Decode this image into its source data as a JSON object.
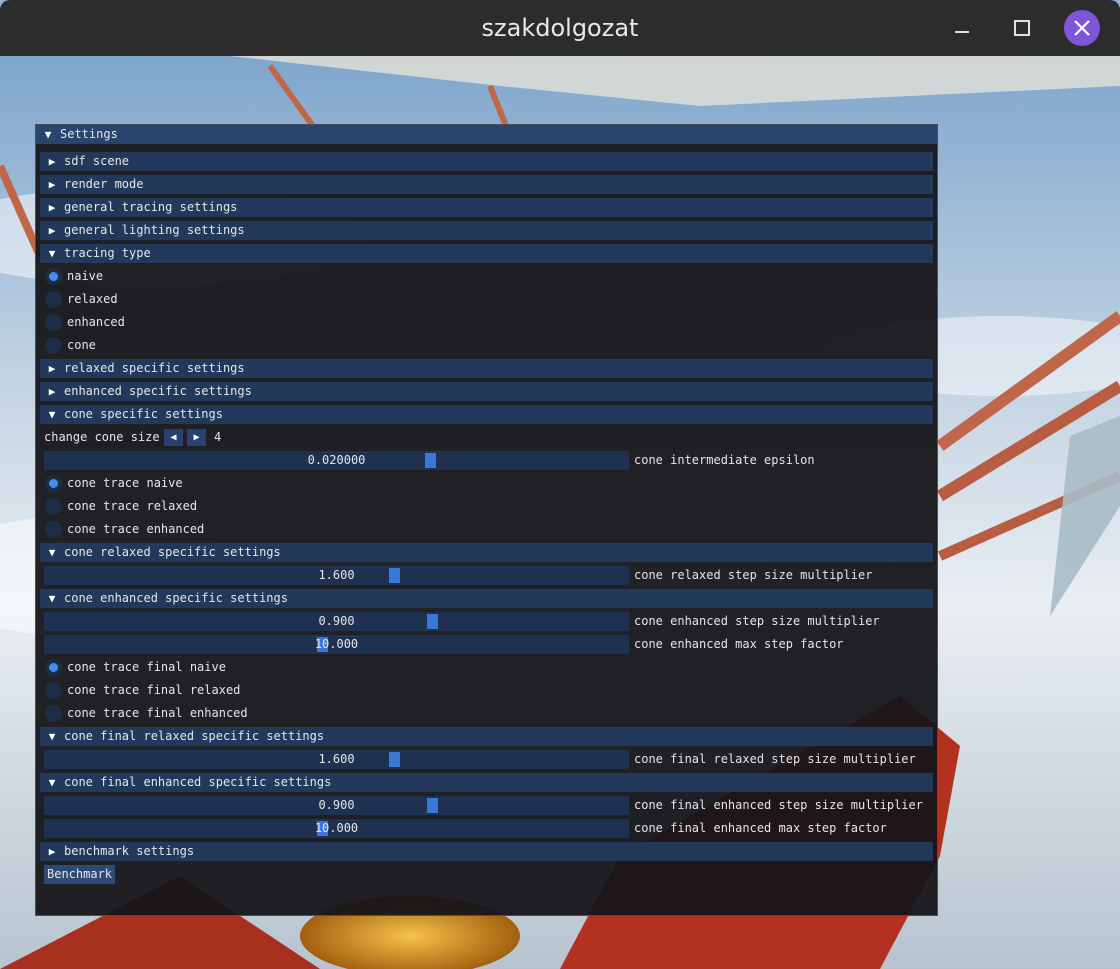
{
  "window": {
    "title": "szakdolgozat"
  },
  "panel": {
    "title": "Settings",
    "sections": {
      "sdf_scene": "sdf scene",
      "render_mode": "render mode",
      "general_tracing": "general tracing settings",
      "general_lighting": "general lighting settings",
      "tracing_type": "tracing type",
      "relaxed_specific": "relaxed specific settings",
      "enhanced_specific": "enhanced specific settings",
      "cone_specific": "cone specific settings",
      "cone_relaxed_specific": "cone relaxed specific settings",
      "cone_enhanced_specific": "cone enhanced specific settings",
      "cone_final_relaxed_specific": "cone final relaxed specific settings",
      "cone_final_enhanced_specific": "cone final enhanced specific settings",
      "benchmark_settings": "benchmark settings"
    },
    "tracing_type_options": [
      "naive",
      "relaxed",
      "enhanced",
      "cone"
    ],
    "tracing_type_selected": "naive",
    "cone_size": {
      "label": "change cone size",
      "value": "4"
    },
    "cone_intermediate_epsilon": {
      "label": "cone intermediate epsilon",
      "value": "0.020000"
    },
    "cone_trace_options": [
      "cone trace naive",
      "cone trace relaxed",
      "cone trace enhanced"
    ],
    "cone_trace_selected": "cone trace naive",
    "cone_relaxed_step": {
      "label": "cone relaxed step size multiplier",
      "value": "1.600"
    },
    "cone_enhanced_step": {
      "label": "cone enhanced step size multiplier",
      "value": "0.900"
    },
    "cone_enhanced_max": {
      "label": "cone enhanced max step factor",
      "value": "10.000"
    },
    "cone_trace_final_options": [
      "cone trace final naive",
      "cone trace final relaxed",
      "cone trace final enhanced"
    ],
    "cone_trace_final_selected": "cone trace final naive",
    "cone_final_relaxed_step": {
      "label": "cone final relaxed step size multiplier",
      "value": "1.600"
    },
    "cone_final_enhanced_step": {
      "label": "cone final enhanced step size multiplier",
      "value": "0.900"
    },
    "cone_final_enhanced_max": {
      "label": "cone final enhanced max step factor",
      "value": "10.000"
    },
    "benchmark_button": "Benchmark"
  },
  "colors": {
    "header": "#22395b",
    "title_bar": "#29456e",
    "slider_frame": "#1e3150",
    "slider_grab": "#3a78d8",
    "radio_on": "#4a8df2"
  },
  "icons": {
    "collapsed": "triangle-right-icon",
    "expanded": "triangle-down-icon"
  }
}
